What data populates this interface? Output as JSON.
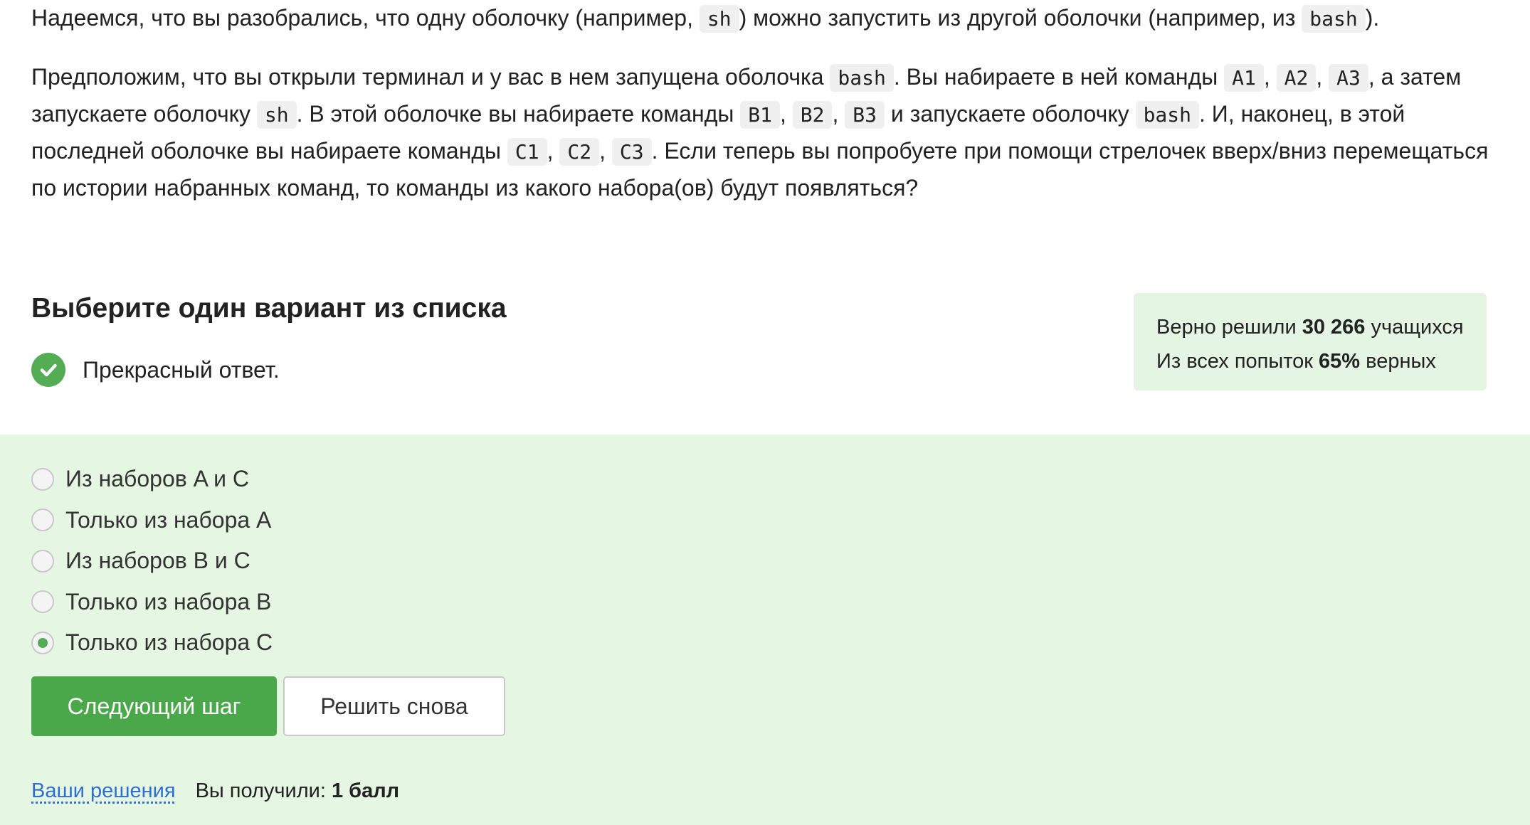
{
  "question": {
    "p1": {
      "t1": "Надеемся, что вы разобрались, что одну оболочку (например, ",
      "c1": "sh",
      "t2": ") можно запустить из другой оболочки (например, из ",
      "c2": "bash",
      "t3": ")."
    },
    "p2": {
      "t1": "Предположим, что вы открыли терминал и у вас в нем запущена оболочка ",
      "c1": "bash",
      "t2": ". Вы набираете в ней команды ",
      "a1": "A1",
      "sep1": ", ",
      "a2": "A2",
      "sep2": ", ",
      "a3": "A3",
      "t3": ", а затем запускаете оболочку ",
      "c2": "sh",
      "t4": ". В этой оболочке вы набираете команды ",
      "b1": "B1",
      "sep3": ", ",
      "b2": "B2",
      "sep4": ", ",
      "b3": "B3",
      "t5": " и запускаете оболочку ",
      "c3": "bash",
      "t6": ". И, наконец, в этой последней оболочке вы набираете команды ",
      "cc1": "C1",
      "sep5": ", ",
      "cc2": "C2",
      "sep6": ", ",
      "cc3": "C3",
      "t7": ". Если теперь вы попробуете при помощи стрелочек вверх/вниз перемещаться по истории набранных команд, то команды из какого набора(ов) будут появляться?"
    }
  },
  "select_title": "Выберите один вариант из списка",
  "feedback": {
    "text": "Прекрасный ответ.",
    "icon": "check-icon",
    "color": "#54ad54"
  },
  "stats": {
    "line1_prefix": "Верно решили ",
    "line1_value": "30 266",
    "line1_suffix": " учащихся",
    "line2_prefix": "Из всех попыток ",
    "line2_value": "65%",
    "line2_suffix": " верных"
  },
  "options": [
    {
      "label": "Из наборов A и C",
      "checked": false
    },
    {
      "label": "Только из набора A",
      "checked": false
    },
    {
      "label": "Из наборов B и C",
      "checked": false
    },
    {
      "label": "Только из набора B",
      "checked": false
    },
    {
      "label": "Только из набора C",
      "checked": true
    }
  ],
  "buttons": {
    "next": "Следующий шаг",
    "retry": "Решить снова"
  },
  "footer": {
    "link": "Ваши решения",
    "score_prefix": "Вы получили: ",
    "score_value": "1 балл"
  }
}
